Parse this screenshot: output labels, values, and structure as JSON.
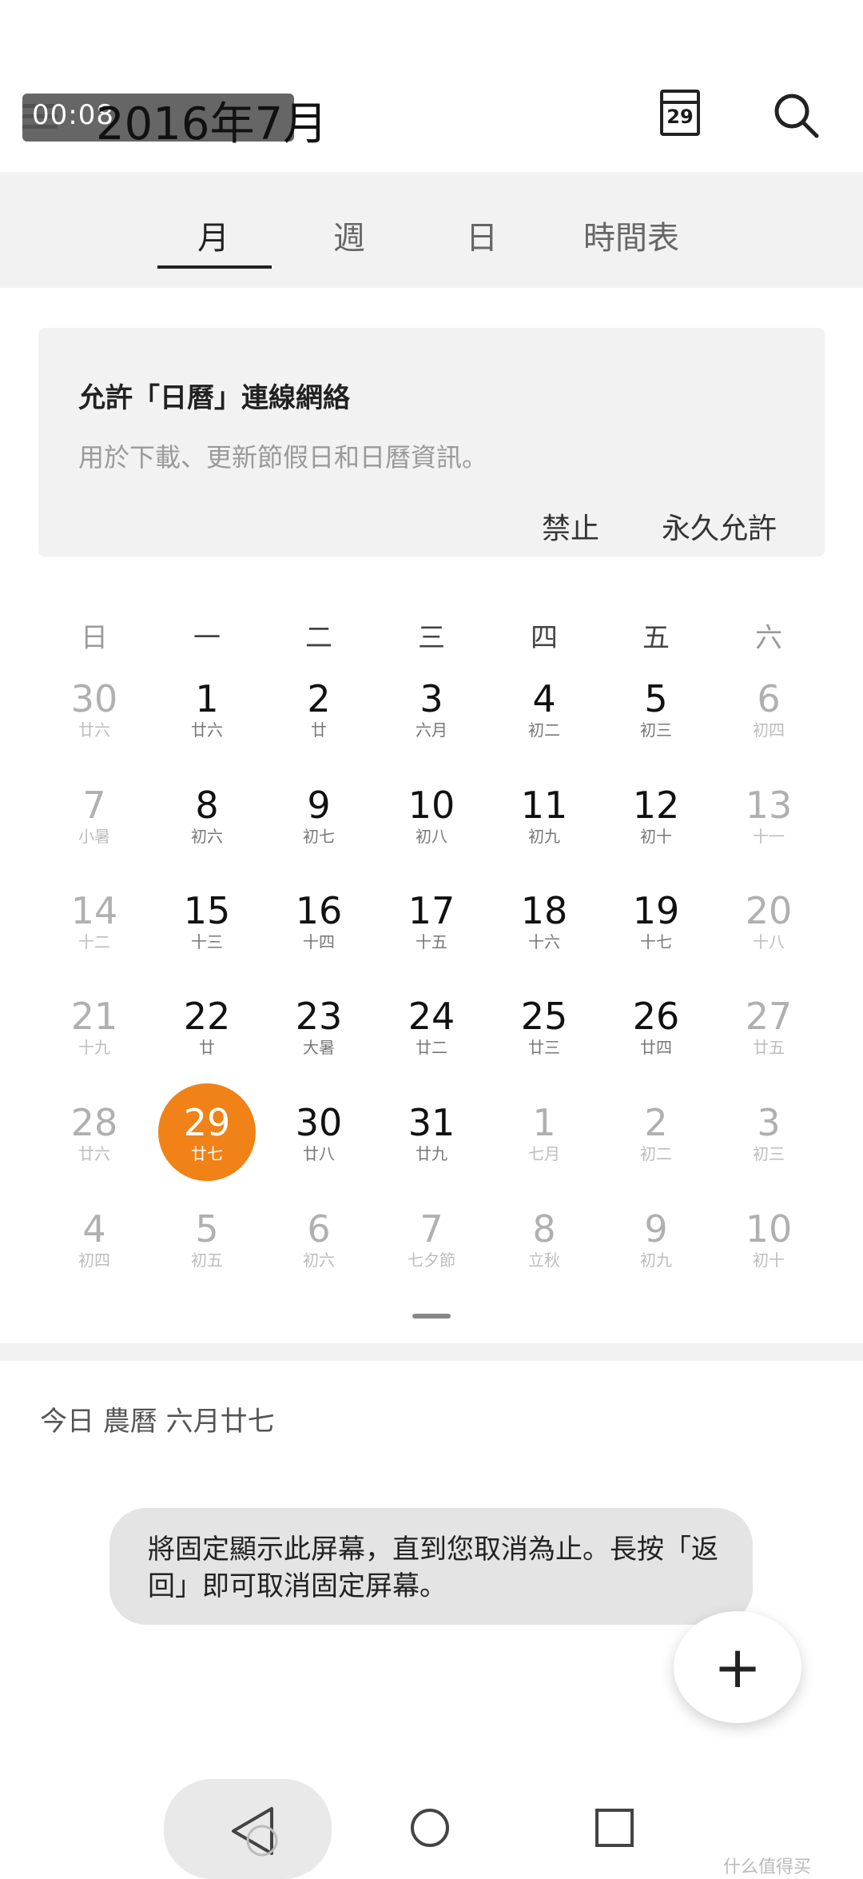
{
  "header": {
    "time_overlay": "00:08",
    "month_title": "2016年7月",
    "calendar_icon_day": "29"
  },
  "tabs": [
    {
      "label": "月",
      "active": true
    },
    {
      "label": "週",
      "active": false
    },
    {
      "label": "日",
      "active": false
    },
    {
      "label": "時間表",
      "active": false
    }
  ],
  "permission_card": {
    "title": "允許「日曆」連線網絡",
    "description": "用於下載、更新節假日和日曆資訊。",
    "deny_label": "禁止",
    "allow_label": "永久允許"
  },
  "weekdays": [
    "日",
    "一",
    "二",
    "三",
    "四",
    "五",
    "六"
  ],
  "weeks": [
    [
      {
        "n": "30",
        "l": "廿六",
        "dim": true
      },
      {
        "n": "1",
        "l": "廿六"
      },
      {
        "n": "2",
        "l": "廿"
      },
      {
        "n": "3",
        "l": "六月"
      },
      {
        "n": "4",
        "l": "初二"
      },
      {
        "n": "5",
        "l": "初三"
      },
      {
        "n": "6",
        "l": "初四",
        "dim": true
      }
    ],
    [
      {
        "n": "7",
        "l": "小暑",
        "dim": true
      },
      {
        "n": "8",
        "l": "初六"
      },
      {
        "n": "9",
        "l": "初七"
      },
      {
        "n": "10",
        "l": "初八"
      },
      {
        "n": "11",
        "l": "初九"
      },
      {
        "n": "12",
        "l": "初十"
      },
      {
        "n": "13",
        "l": "十一",
        "dim": true
      }
    ],
    [
      {
        "n": "14",
        "l": "十二",
        "dim": true
      },
      {
        "n": "15",
        "l": "十三"
      },
      {
        "n": "16",
        "l": "十四"
      },
      {
        "n": "17",
        "l": "十五"
      },
      {
        "n": "18",
        "l": "十六"
      },
      {
        "n": "19",
        "l": "十七"
      },
      {
        "n": "20",
        "l": "十八",
        "dim": true
      }
    ],
    [
      {
        "n": "21",
        "l": "十九",
        "dim": true
      },
      {
        "n": "22",
        "l": "廿"
      },
      {
        "n": "23",
        "l": "大暑"
      },
      {
        "n": "24",
        "l": "廿二"
      },
      {
        "n": "25",
        "l": "廿三"
      },
      {
        "n": "26",
        "l": "廿四"
      },
      {
        "n": "27",
        "l": "廿五",
        "dim": true
      }
    ],
    [
      {
        "n": "28",
        "l": "廿六",
        "dim": true
      },
      {
        "n": "29",
        "l": "廿七",
        "today": true
      },
      {
        "n": "30",
        "l": "廿八"
      },
      {
        "n": "31",
        "l": "廿九"
      },
      {
        "n": "1",
        "l": "七月",
        "dim": true
      },
      {
        "n": "2",
        "l": "初二",
        "dim": true
      },
      {
        "n": "3",
        "l": "初三",
        "dim": true
      }
    ],
    [
      {
        "n": "4",
        "l": "初四",
        "dim": true
      },
      {
        "n": "5",
        "l": "初五",
        "dim": true
      },
      {
        "n": "6",
        "l": "初六",
        "dim": true
      },
      {
        "n": "7",
        "l": "七夕節",
        "dim": true
      },
      {
        "n": "8",
        "l": "立秋",
        "dim": true
      },
      {
        "n": "9",
        "l": "初九",
        "dim": true
      },
      {
        "n": "10",
        "l": "初十",
        "dim": true
      }
    ]
  ],
  "today_info": "今日 農曆 六月廿七",
  "toast": "將固定顯示此屏幕，直到您取消為止。長按「返回」即可取消固定屏幕。",
  "fab_label": "+",
  "watermark": "什么值得买",
  "colors": {
    "accent": "#f08218",
    "band": "#f2f2f2"
  }
}
